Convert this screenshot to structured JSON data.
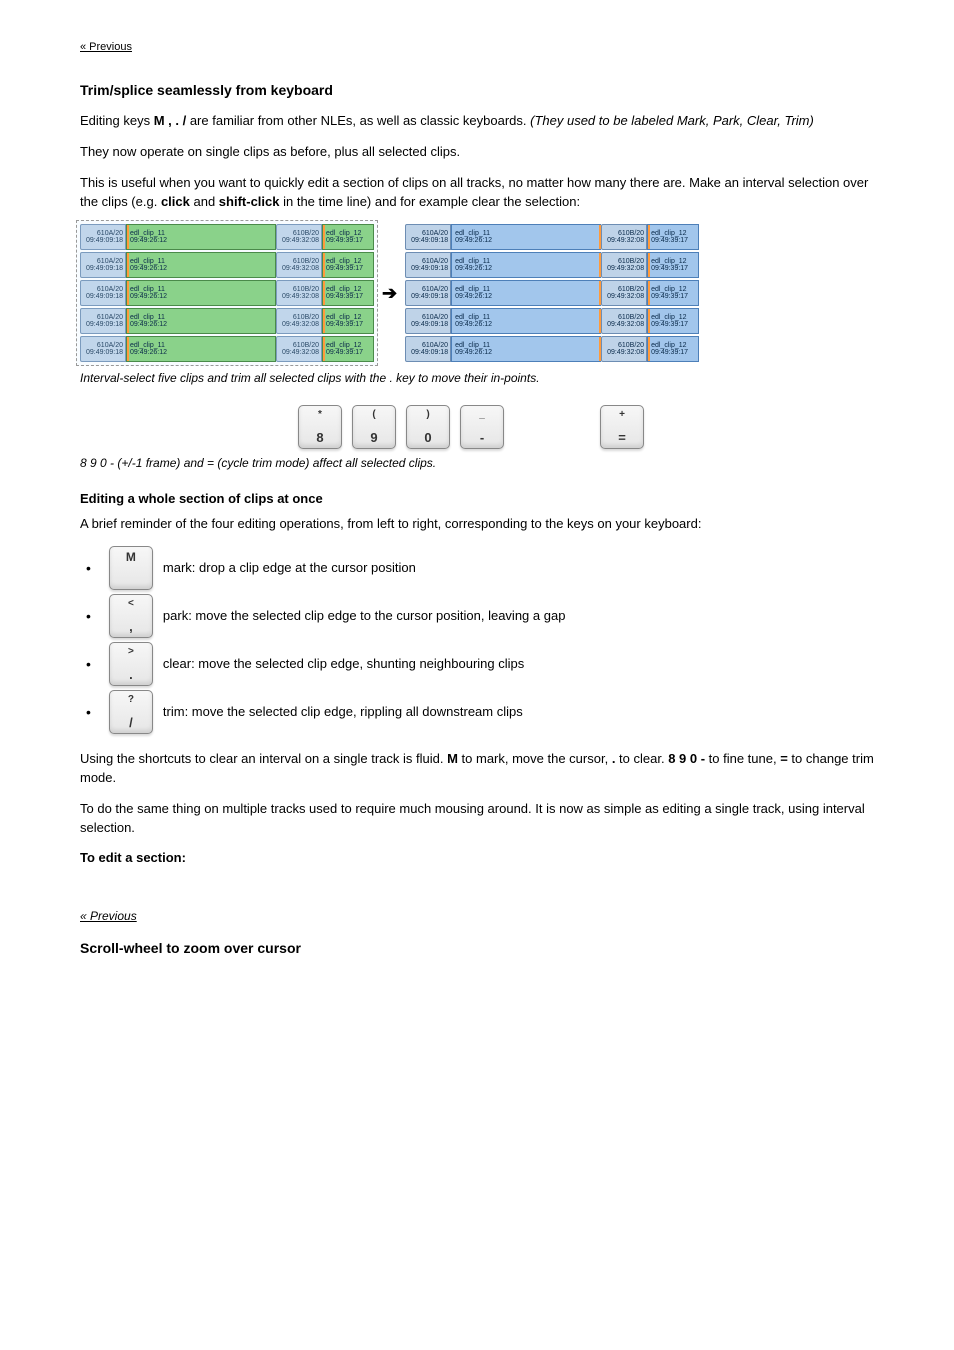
{
  "topBackLink": "« Previous",
  "headingTrimSplice": "Trim/splice seamlessly from keyboard",
  "para1_prefix": "Editing keys ",
  "para1_bold": "M , . /",
  "para1_mid": " are familiar from other NLEs, as well as classic keyboards. ",
  "para1_italic": "(They used to be labeled Mark, Park, Clear, Trim)",
  "para2": "They now operate on single clips as before, plus all selected clips.",
  "para3_a": "This is useful when you want to quickly edit a section of clips on all tracks, no matter how many there are. Make an interval selection over the clips (e.g. ",
  "para3_bold1": "click",
  "para3_b": " and ",
  "para3_bold2": "shift-click",
  "para3_c": " in the time line) and for example clear the selection:",
  "clipA_label": "610A/20",
  "clipA_tc": "09:49:09:18",
  "clipB_name": "edl_clip_11",
  "clipB_tc": "09:49:26:12",
  "clipC_label": "610B/20",
  "clipC_tc": "09:49:32:08",
  "clipD_name": "edl_clip_12",
  "clipD_tc": "09:49:39:17",
  "clipA2_label": "610A/20",
  "clipA2_tc": "09:49:09:18",
  "clipB2_name": "edl_clip_11",
  "clipB2_tc": "09:49:26:12",
  "clipC2_label": "610B/20",
  "clipC2_tc": "09:49:32:08",
  "clipD2_name": "edl_clip_12",
  "clipD2_tc": "09:49:39:17",
  "arrow": "➔",
  "caption1": "Interval-select five clips and trim all selected clips with the . key to move their in-points.",
  "captionKeys": "8 9 0 - (+/-1 frame) and = (cycle trim mode) affect all selected clips.",
  "key8_top": "*",
  "key8_bot": "8",
  "key9_top": "(",
  "key9_bot": "9",
  "key0_top": ")",
  "key0_bot": "0",
  "keyMinus_top": "_",
  "keyMinus_bot": "-",
  "keyEq_top": "+",
  "keyEq_bot": "=",
  "subhead1": "Editing a whole section of clips at once",
  "para4": "A brief reminder of the four editing operations, from left to right, corresponding to the keys on your keyboard:",
  "liM_top": "M",
  "liM_desc": "mark: drop a clip edge at the cursor position",
  "liComma_top": "<",
  "liComma_bot": ",",
  "liComma_desc": "park: move the selected clip edge to the cursor position, leaving a gap",
  "liPeriod_top": ">",
  "liPeriod_bot": ".",
  "liPeriod_desc": "clear: move the selected clip edge, shunting neighbouring clips",
  "liSlash_top": "?",
  "liSlash_bot": "/",
  "liSlash_desc": "trim: move the selected clip edge, rippling all downstream clips",
  "para5_a": "Using the shortcuts to clear an interval on a single track is fluid. ",
  "para5_bold1": "M",
  "para5_b": " to mark, move the cursor, ",
  "para5_bold2": ".",
  "para5_c": " to clear. ",
  "para5_bold3": "8 9 0 -",
  "para5_d": " to fine tune, ",
  "para5_bold4": "=",
  "para5_e": " to change trim mode.",
  "para6": "To do the same thing on multiple tracks used to require much mousing around. It is now as simple as editing a single track, using interval selection.",
  "subhead2": "To edit a section:",
  "bottomBackLink": "« Previous",
  "trailingHeading": "Scroll-wheel to zoom over cursor"
}
